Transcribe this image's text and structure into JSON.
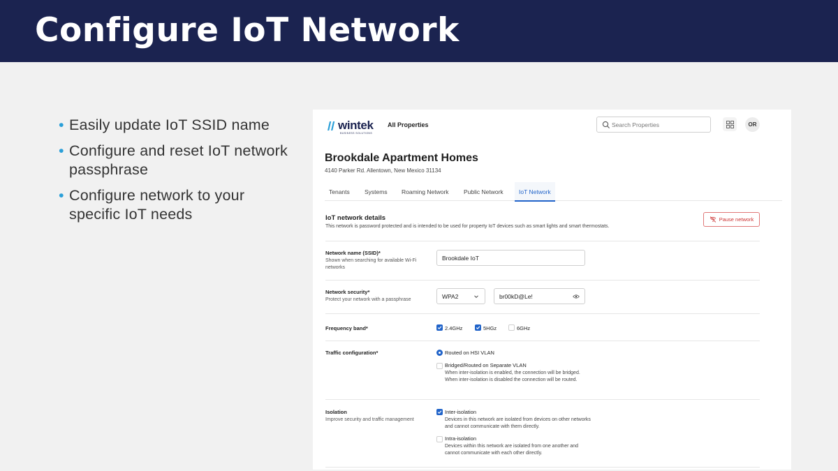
{
  "slide": {
    "title": "Configure IoT Network",
    "bullets": [
      "Easily update IoT SSID name",
      "Configure and reset IoT network passphrase",
      "Configure network to your specific IoT needs"
    ]
  },
  "app": {
    "logo": {
      "word": "wintek",
      "sub": "BUSINESS SOLUTIONS"
    },
    "nav_link": "All Properties",
    "search": {
      "placeholder": "Search Properties"
    },
    "avatar": "OR"
  },
  "property": {
    "title": "Brookdale Apartment Homes",
    "address": "4140 Parker Rd. Allentown, New Mexico 31134"
  },
  "tabs": [
    {
      "label": "Tenants",
      "active": false
    },
    {
      "label": "Systems",
      "active": false
    },
    {
      "label": "Roaming Network",
      "active": false
    },
    {
      "label": "Public Network",
      "active": false
    },
    {
      "label": "IoT Network",
      "active": true
    }
  ],
  "section": {
    "title": "IoT network details",
    "description": "This network is password protected and is intended to be used for property IoT devices such as smart lights and smart thermostats.",
    "pause_label": "Pause network"
  },
  "form": {
    "ssid": {
      "label": "Network name (SSID)*",
      "hint": "Shown when searching for available Wi-Fi networks",
      "value": "Brookdale IoT"
    },
    "security": {
      "label": "Network security*",
      "hint": "Protect your network with a passphrase",
      "mode": "WPA2",
      "passphrase": "br00kD@Le!"
    },
    "frequency": {
      "label": "Frequency band*",
      "options": [
        {
          "label": "2.4GHz",
          "checked": true
        },
        {
          "label": "5HGz",
          "checked": true
        },
        {
          "label": "6GHz",
          "checked": false
        }
      ]
    },
    "traffic": {
      "label": "Traffic configuration*",
      "options": [
        {
          "label": "Routed on HSI VLAN",
          "selected": true,
          "desc": ""
        },
        {
          "label": "Bridged/Routed on Separate VLAN",
          "selected": false,
          "desc": "When inter-isolation is enabled, the connection will be bridged. When inter-isolation is disabled the connection will be routed."
        }
      ]
    },
    "isolation": {
      "label": "Isolation",
      "hint": "Improve security and traffic management",
      "options": [
        {
          "label": "Inter-isolation",
          "checked": true,
          "desc": "Devices in this network are isolated from devices on other networks and cannot communicate with them directly."
        },
        {
          "label": "Intra-isolation",
          "checked": false,
          "desc": "Devices within this network are isolated from one another and cannot communicate with each other directly."
        }
      ]
    }
  },
  "colors": {
    "header_bg": "#1b2350",
    "bullet_dot": "#2a9fd8",
    "accent": "#2063c9",
    "danger": "#c33333"
  }
}
